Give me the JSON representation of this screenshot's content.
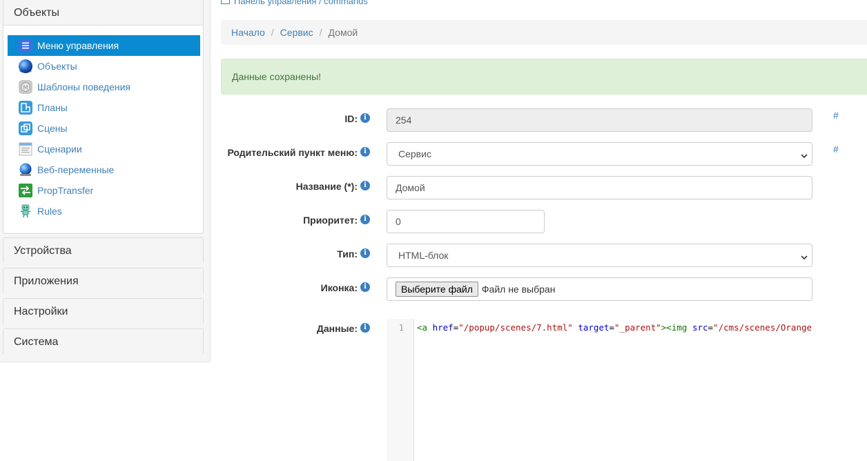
{
  "sidebar": {
    "objects_panel": {
      "title": "Объекты",
      "items": [
        {
          "label": "Меню управления",
          "icon": "menu-list-icon",
          "active": true
        },
        {
          "label": "Объекты",
          "icon": "globe-icon"
        },
        {
          "label": "Шаблоны поведения",
          "icon": "behavior-template-icon"
        },
        {
          "label": "Планы",
          "icon": "floor-plan-icon"
        },
        {
          "label": "Сцены",
          "icon": "scenes-icon"
        },
        {
          "label": "Сценарии",
          "icon": "scripts-icon"
        },
        {
          "label": "Веб-переменные",
          "icon": "web-variables-icon"
        },
        {
          "label": "PropTransfer",
          "icon": "prop-transfer-icon"
        },
        {
          "label": "Rules",
          "icon": "robot-icon"
        }
      ]
    },
    "panels": [
      "Устройства",
      "Приложения",
      "Настройки",
      "Система"
    ]
  },
  "topcrumb": "Панель управления / commands",
  "breadcrumb": {
    "home": "Начало",
    "parent": "Сервис",
    "current": "Домой",
    "separator": "/"
  },
  "alert": {
    "text": "Данные сохранены!"
  },
  "form": {
    "id": {
      "label": "ID:",
      "value": "254"
    },
    "parent": {
      "label": "Родительский пункт меню:",
      "value": "Сервис"
    },
    "title": {
      "label": "Название (*):",
      "value": "Домой"
    },
    "priority": {
      "label": "Приоритет:",
      "value": "0"
    },
    "type": {
      "label": "Тип:",
      "value": "HTML-блок"
    },
    "icon": {
      "label": "Иконка:",
      "button": "Выберите файл",
      "status": "Файл не выбран"
    },
    "data": {
      "label": "Данные:",
      "line_number": "1",
      "code": {
        "tag_open": "<a",
        "attr1": "href",
        "eq1": "=",
        "val1": "\"/popup/scenes/7.html\"",
        "attr2": "target",
        "eq2": "=",
        "val2": "\"_parent\"",
        "tag2": "><img",
        "attr3": "src",
        "eq3": "=",
        "val3": "\"/cms/scenes/Orange"
      }
    },
    "hash": "#"
  },
  "colors": {
    "accent": "#0a8bd1",
    "link": "#3f81b8",
    "alert_bg": "#dff0d8",
    "alert_text": "#3c763d"
  }
}
